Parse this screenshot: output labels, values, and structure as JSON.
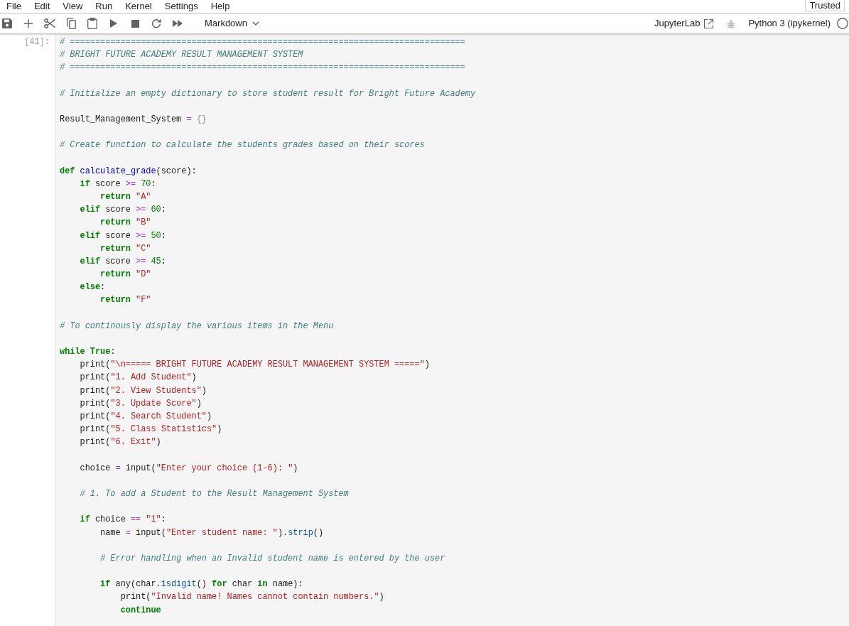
{
  "menu_bar": {
    "items": [
      "File",
      "Edit",
      "View",
      "Run",
      "Kernel",
      "Settings",
      "Help"
    ],
    "trusted": "Trusted"
  },
  "toolbar": {
    "cell_type": "Markdown",
    "jupyterlab_link": "JupyterLab",
    "debugger_enabled": false,
    "kernel_name": "Python 3 (ipykernel)",
    "kernel_busy": false
  },
  "cell": {
    "prompt": "[41]:",
    "lines": [
      {
        "kind": "code",
        "tokens": [
          {
            "kind": "comment",
            "text": "# =============================================================================="
          }
        ]
      },
      {
        "kind": "code",
        "tokens": [
          {
            "kind": "comment",
            "text": "# BRIGHT FUTURE ACADEMY RESULT MANAGEMENT SYSTEM"
          }
        ]
      },
      {
        "kind": "code",
        "tokens": [
          {
            "kind": "comment",
            "text": "# =============================================================================="
          }
        ]
      },
      {
        "kind": "blank"
      },
      {
        "kind": "code",
        "tokens": [
          {
            "kind": "comment",
            "text": "# Initialize an empty dictionary to store student result for Bright Future Academy"
          }
        ]
      },
      {
        "kind": "blank"
      },
      {
        "kind": "code",
        "tokens": [
          {
            "kind": "plain",
            "text": "Result_Management_System"
          },
          {
            "kind": "operator",
            "text": " = "
          },
          {
            "kind": "bracket",
            "text": "{}"
          }
        ]
      },
      {
        "kind": "blank"
      },
      {
        "kind": "code",
        "tokens": [
          {
            "kind": "comment",
            "text": "# Create function to calculate the students grades based on their scores"
          }
        ]
      },
      {
        "kind": "blank"
      },
      {
        "kind": "code",
        "tokens": [
          {
            "kind": "keyword",
            "text": "def"
          },
          {
            "kind": "function",
            "text": " calculate_grade"
          },
          {
            "kind": "plain",
            "text": "(score):"
          }
        ]
      },
      {
        "kind": "code",
        "tokens": [
          {
            "kind": "keyword",
            "text": "    if"
          },
          {
            "kind": "plain",
            "text": " score "
          },
          {
            "kind": "operator",
            "text": ">="
          },
          {
            "kind": "number",
            "text": " 70"
          },
          {
            "kind": "plain",
            "text": ":"
          }
        ]
      },
      {
        "kind": "code",
        "tokens": [
          {
            "kind": "keyword",
            "text": "        return"
          },
          {
            "kind": "string",
            "text": " \"A\""
          }
        ]
      },
      {
        "kind": "code",
        "tokens": [
          {
            "kind": "keyword",
            "text": "    elif"
          },
          {
            "kind": "plain",
            "text": " score "
          },
          {
            "kind": "operator",
            "text": ">="
          },
          {
            "kind": "number",
            "text": " 60"
          },
          {
            "kind": "plain",
            "text": ":"
          }
        ]
      },
      {
        "kind": "code",
        "tokens": [
          {
            "kind": "keyword",
            "text": "        return"
          },
          {
            "kind": "string",
            "text": " \"B\""
          }
        ]
      },
      {
        "kind": "code",
        "tokens": [
          {
            "kind": "keyword",
            "text": "    elif"
          },
          {
            "kind": "plain",
            "text": " score "
          },
          {
            "kind": "operator",
            "text": ">="
          },
          {
            "kind": "number",
            "text": " 50"
          },
          {
            "kind": "plain",
            "text": ":"
          }
        ]
      },
      {
        "kind": "code",
        "tokens": [
          {
            "kind": "keyword",
            "text": "        return"
          },
          {
            "kind": "string",
            "text": " \"C\""
          }
        ]
      },
      {
        "kind": "code",
        "tokens": [
          {
            "kind": "keyword",
            "text": "    elif"
          },
          {
            "kind": "plain",
            "text": " score "
          },
          {
            "kind": "operator",
            "text": ">="
          },
          {
            "kind": "number",
            "text": " 45"
          },
          {
            "kind": "plain",
            "text": ":"
          }
        ]
      },
      {
        "kind": "code",
        "tokens": [
          {
            "kind": "keyword",
            "text": "        return"
          },
          {
            "kind": "string",
            "text": " \"D\""
          }
        ]
      },
      {
        "kind": "code",
        "tokens": [
          {
            "kind": "keyword",
            "text": "    else"
          },
          {
            "kind": "plain",
            "text": ":"
          }
        ]
      },
      {
        "kind": "code",
        "tokens": [
          {
            "kind": "keyword",
            "text": "        return"
          },
          {
            "kind": "string",
            "text": " \"F\""
          }
        ]
      },
      {
        "kind": "blank"
      },
      {
        "kind": "code",
        "tokens": [
          {
            "kind": "comment",
            "text": "# To continously display the various items in the Menu"
          }
        ]
      },
      {
        "kind": "blank"
      },
      {
        "kind": "code",
        "tokens": [
          {
            "kind": "keyword",
            "text": "while"
          },
          {
            "kind": "keyword",
            "text": " True"
          },
          {
            "kind": "plain",
            "text": ":"
          }
        ]
      },
      {
        "kind": "code",
        "tokens": [
          {
            "kind": "plain",
            "text": "    print("
          },
          {
            "kind": "string",
            "text": "\"\\n===== BRIGHT FUTURE ACADEMY RESULT MANAGEMENT SYSTEM =====\""
          },
          {
            "kind": "plain",
            "text": ")"
          }
        ]
      },
      {
        "kind": "code",
        "tokens": [
          {
            "kind": "plain",
            "text": "    print("
          },
          {
            "kind": "string",
            "text": "\"1. Add Student\""
          },
          {
            "kind": "plain",
            "text": ")"
          }
        ]
      },
      {
        "kind": "code",
        "tokens": [
          {
            "kind": "plain",
            "text": "    print("
          },
          {
            "kind": "string",
            "text": "\"2. View Students\""
          },
          {
            "kind": "plain",
            "text": ")"
          }
        ]
      },
      {
        "kind": "code",
        "tokens": [
          {
            "kind": "plain",
            "text": "    print("
          },
          {
            "kind": "string",
            "text": "\"3. Update Score\""
          },
          {
            "kind": "plain",
            "text": ")"
          }
        ]
      },
      {
        "kind": "code",
        "tokens": [
          {
            "kind": "plain",
            "text": "    print("
          },
          {
            "kind": "string",
            "text": "\"4. Search Student\""
          },
          {
            "kind": "plain",
            "text": ")"
          }
        ]
      },
      {
        "kind": "code",
        "tokens": [
          {
            "kind": "plain",
            "text": "    print("
          },
          {
            "kind": "string",
            "text": "\"5. Class Statistics\""
          },
          {
            "kind": "plain",
            "text": ")"
          }
        ]
      },
      {
        "kind": "code",
        "tokens": [
          {
            "kind": "plain",
            "text": "    print("
          },
          {
            "kind": "string",
            "text": "\"6. Exit\""
          },
          {
            "kind": "plain",
            "text": ")"
          }
        ]
      },
      {
        "kind": "blank"
      },
      {
        "kind": "code",
        "tokens": [
          {
            "kind": "plain",
            "text": "    choice"
          },
          {
            "kind": "operator",
            "text": " = "
          },
          {
            "kind": "plain",
            "text": "input("
          },
          {
            "kind": "string",
            "text": "\"Enter your choice (1-6): \""
          },
          {
            "kind": "plain",
            "text": ")"
          }
        ]
      },
      {
        "kind": "blank"
      },
      {
        "kind": "code",
        "tokens": [
          {
            "kind": "comment",
            "text": "    # 1. To add a Student to the Result Management System"
          }
        ]
      },
      {
        "kind": "blank"
      },
      {
        "kind": "code",
        "tokens": [
          {
            "kind": "keyword",
            "text": "    if"
          },
          {
            "kind": "plain",
            "text": " choice "
          },
          {
            "kind": "operator",
            "text": "=="
          },
          {
            "kind": "string",
            "text": " \"1\""
          },
          {
            "kind": "plain",
            "text": ":"
          }
        ]
      },
      {
        "kind": "code",
        "tokens": [
          {
            "kind": "plain",
            "text": "        name"
          },
          {
            "kind": "operator",
            "text": " = "
          },
          {
            "kind": "plain",
            "text": "input("
          },
          {
            "kind": "string",
            "text": "\"Enter student name: \""
          },
          {
            "kind": "plain",
            "text": ")."
          },
          {
            "kind": "method",
            "text": "strip"
          },
          {
            "kind": "plain",
            "text": "()"
          }
        ]
      },
      {
        "kind": "blank"
      },
      {
        "kind": "code",
        "tokens": [
          {
            "kind": "comment",
            "text": "        # Error handling when an Invalid student name is entered by the user"
          }
        ]
      },
      {
        "kind": "blank"
      },
      {
        "kind": "code",
        "tokens": [
          {
            "kind": "keyword",
            "text": "        if"
          },
          {
            "kind": "plain",
            "text": " any(char."
          },
          {
            "kind": "method",
            "text": "isdigit"
          },
          {
            "kind": "plain",
            "text": "() "
          },
          {
            "kind": "keyword",
            "text": "for"
          },
          {
            "kind": "plain",
            "text": " char "
          },
          {
            "kind": "keyword",
            "text": "in"
          },
          {
            "kind": "plain",
            "text": " name):"
          }
        ]
      },
      {
        "kind": "code",
        "tokens": [
          {
            "kind": "plain",
            "text": "            print("
          },
          {
            "kind": "string",
            "text": "\"Invalid name! Names cannot contain numbers.\""
          },
          {
            "kind": "plain",
            "text": ")"
          }
        ]
      },
      {
        "kind": "code",
        "tokens": [
          {
            "kind": "keyword",
            "text": "            continue"
          }
        ]
      }
    ]
  }
}
